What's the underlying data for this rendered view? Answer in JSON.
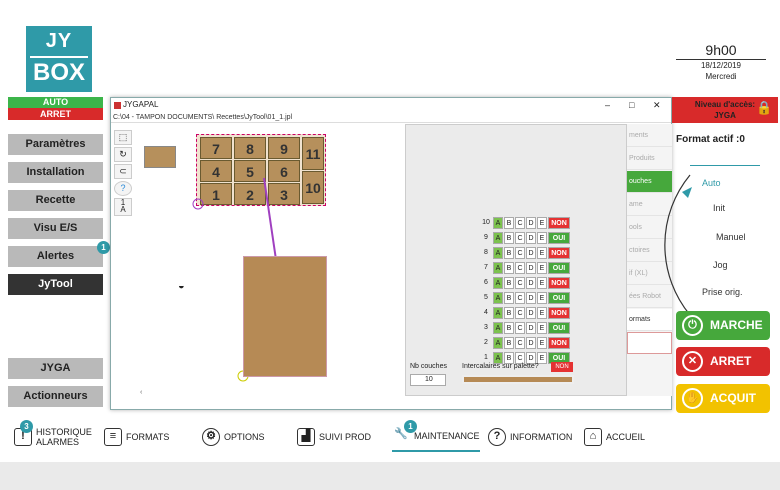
{
  "logo": {
    "line1": "JY",
    "line2": "BOX"
  },
  "clock": {
    "time": "9h00",
    "date": "18/12/2019",
    "day": "Mercredi"
  },
  "status": {
    "auto": "AUTO",
    "arret": "ARRET"
  },
  "sidebar": {
    "items": [
      {
        "label": "Paramètres"
      },
      {
        "label": "Installation"
      },
      {
        "label": "Recette"
      },
      {
        "label": "Visu E/S"
      },
      {
        "label": "Alertes",
        "badge": "1"
      },
      {
        "label": "JyTool"
      },
      {
        "label": "JYGA"
      },
      {
        "label": "Actionneurs"
      }
    ]
  },
  "window": {
    "title": "JYGAPAL",
    "path": "C:\\04 - TAMPON DOCUMENTS\\ Recettes\\JyTool\\01_1.jpl",
    "tool_one": "1",
    "tool_a": "A",
    "tool_help": "?"
  },
  "pallet": {
    "boxes": [
      "7",
      "8",
      "9",
      "11",
      "4",
      "5",
      "6",
      "10",
      "1",
      "2",
      "3"
    ]
  },
  "layers": {
    "rows": [
      {
        "n": "10",
        "status": "NON"
      },
      {
        "n": "9",
        "status": "OUI"
      },
      {
        "n": "8",
        "status": "NON"
      },
      {
        "n": "7",
        "status": "OUI"
      },
      {
        "n": "6",
        "status": "NON"
      },
      {
        "n": "5",
        "status": "OUI"
      },
      {
        "n": "4",
        "status": "NON"
      },
      {
        "n": "3",
        "status": "OUI"
      },
      {
        "n": "2",
        "status": "NON"
      },
      {
        "n": "1",
        "status": "OUI"
      }
    ],
    "letters": [
      "A",
      "B",
      "C",
      "D",
      "E"
    ],
    "nb_label": "Nb couches",
    "nb_value": "10",
    "inter_label": "Intercalaires sur palette?",
    "inter_value": "NON"
  },
  "window_menu": [
    "ments",
    "Produits",
    "ouches",
    "ame",
    "ools",
    "ctoires",
    "if (XL)",
    "ées Robot",
    "ormats"
  ],
  "access": {
    "line1": "Niveau d'accès:",
    "line2": "JYGA"
  },
  "format": "Format actif :0",
  "modes": [
    "Auto",
    "Init",
    "Manuel",
    "Jog",
    "Prise orig."
  ],
  "buttons": {
    "marche": "MARCHE",
    "arret": "ARRET",
    "acquit": "ACQUIT"
  },
  "bottom": {
    "historique_line1": "HISTORIQUE",
    "historique_line2": "ALARMES",
    "historique_badge": "3",
    "formats": "FORMATS",
    "options": "OPTIONS",
    "suivi": "SUIVI PROD",
    "maintenance": "MAINTENANCE",
    "maintenance_badge": "1",
    "information": "INFORMATION",
    "accueil": "ACCUEIL"
  }
}
